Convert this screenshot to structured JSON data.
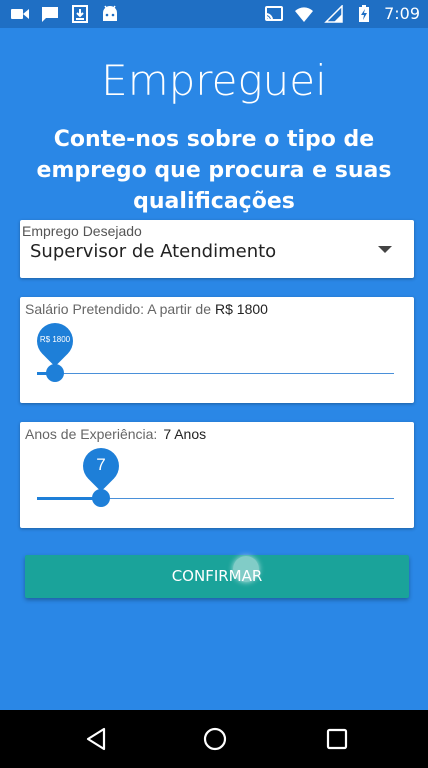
{
  "status_bar": {
    "time": "7:09",
    "left_icons": [
      "video-icon",
      "message-icon",
      "download-icon",
      "android-icon"
    ],
    "right_icons": [
      "cast-icon",
      "wifi-icon",
      "signal-icon",
      "battery-charging-icon"
    ]
  },
  "app": {
    "title": "Empreguei",
    "subtitle": "Conte-nos sobre o tipo de emprego que procura e suas qualificações"
  },
  "job_field": {
    "label": "Emprego Desejado",
    "value": "Supervisor de Atendimento",
    "icon": "dropdown-arrow-icon"
  },
  "salary_slider": {
    "label": "Salário Pretendido: A partir de",
    "value_text": "R$ 1800",
    "pin_text": "R$ 1800",
    "fraction": 0.05
  },
  "experience_slider": {
    "label": "Anos de Experiência:",
    "value_text": "7 Anos",
    "pin_text": "7",
    "fraction": 0.18
  },
  "confirm_button": {
    "label": "CONFIRMAR"
  },
  "nav_bar": {
    "icons": [
      "back-icon",
      "home-icon",
      "recents-icon"
    ]
  },
  "colors": {
    "background": "#2a87e6",
    "status_bar": "#1f6fc4",
    "accent": "#1e7fd8",
    "button": "#1aa39a"
  }
}
